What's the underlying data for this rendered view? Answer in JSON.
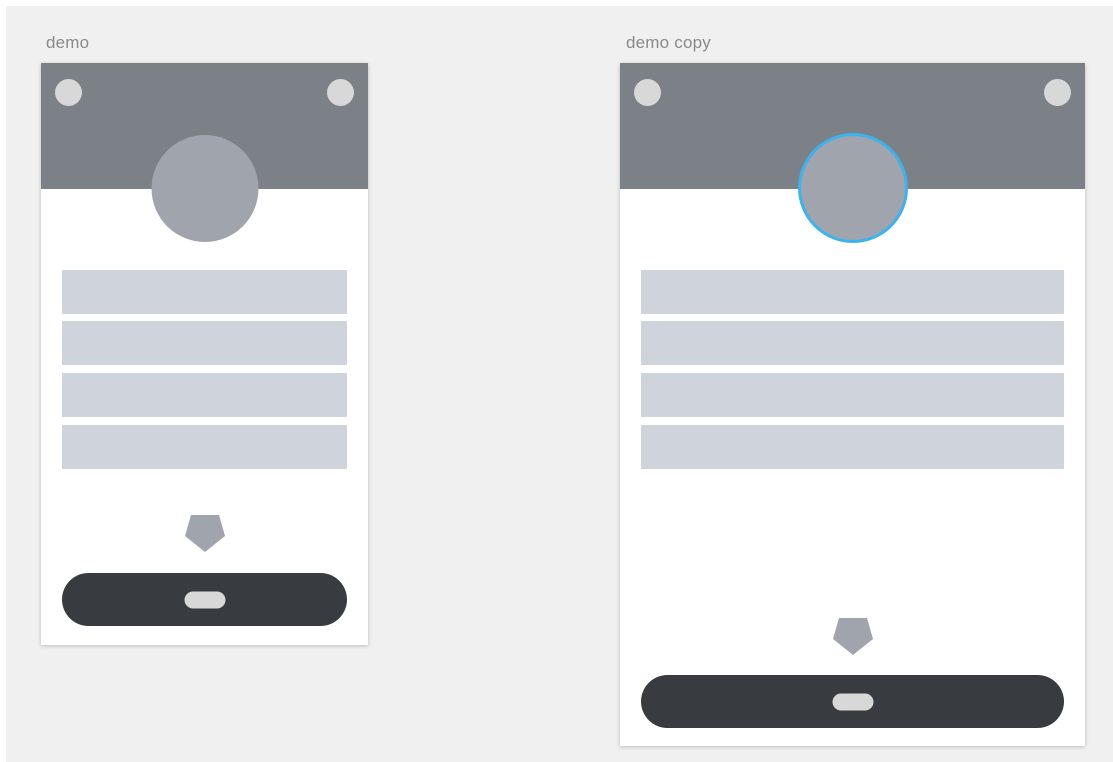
{
  "artboards": [
    {
      "label": "demo",
      "avatar_selected": false
    },
    {
      "label": "demo copy",
      "avatar_selected": true
    }
  ],
  "colors": {
    "canvas_background": "#f0f0f0",
    "header_bar": "#7b8187",
    "corner_dot": "#d8d8d8",
    "avatar": "#a0a4ac",
    "selection_outline": "#3bb3f0",
    "field": "#cfd3dc",
    "pentagon": "#a0a4ac",
    "button": "#383c40",
    "button_pill": "#d8d8d8"
  },
  "icons": {
    "corner_left": "circle-placeholder-icon",
    "corner_right": "circle-placeholder-icon",
    "center_shape": "pentagon-icon"
  }
}
